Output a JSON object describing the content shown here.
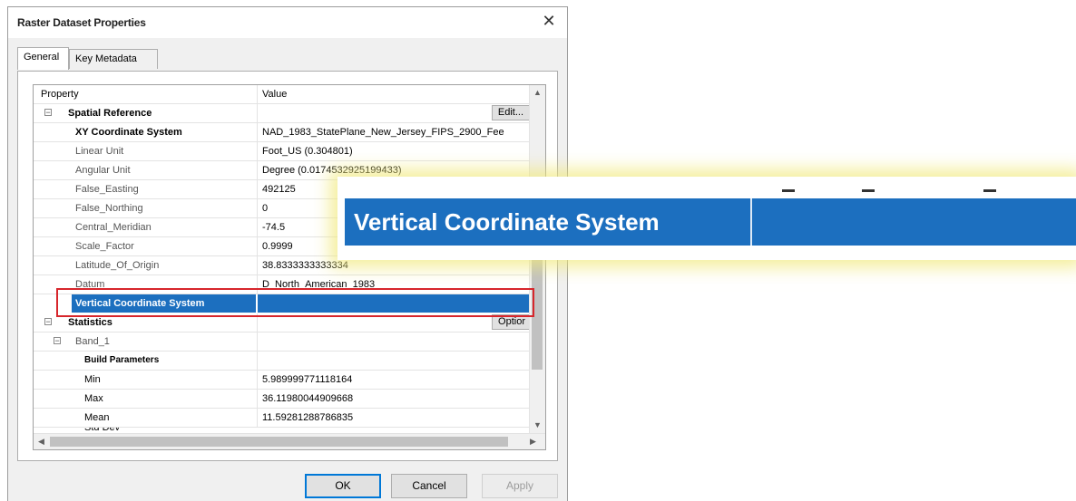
{
  "window": {
    "title": "Raster Dataset Properties",
    "close_glyph": "✕"
  },
  "tabs": [
    {
      "label": "General",
      "active": true
    },
    {
      "label": "Key Metadata",
      "active": false
    }
  ],
  "grid": {
    "header": {
      "property": "Property",
      "value": "Value"
    },
    "rows": [
      {
        "property": "Spatial Reference",
        "value": "",
        "button": "Edit..."
      },
      {
        "property": "XY Coordinate System",
        "value": "NAD_1983_StatePlane_New_Jersey_FIPS_2900_Fee"
      },
      {
        "property": "Linear Unit",
        "value": "Foot_US (0.304801)"
      },
      {
        "property": "Angular Unit",
        "value": "Degree (0.0174532925199433)"
      },
      {
        "property": "False_Easting",
        "value": "492125"
      },
      {
        "property": "False_Northing",
        "value": "0"
      },
      {
        "property": "Central_Meridian",
        "value": "-74.5"
      },
      {
        "property": "Scale_Factor",
        "value": "0.9999"
      },
      {
        "property": "Latitude_Of_Origin",
        "value": "38.8333333333334"
      },
      {
        "property": "Datum",
        "value": "D_North_American_1983"
      },
      {
        "property": "Vertical Coordinate System",
        "value": ""
      },
      {
        "property": "Statistics",
        "value": "",
        "button": "Optior"
      },
      {
        "property": "Band_1",
        "value": ""
      },
      {
        "property": "Build Parameters",
        "value": ""
      },
      {
        "property": "Min",
        "value": "5.989999771118164"
      },
      {
        "property": "Max",
        "value": "36.11980044909668"
      },
      {
        "property": "Mean",
        "value": "11.59281288786835"
      },
      {
        "property": "Std Dev",
        "value": ""
      }
    ]
  },
  "buttons": {
    "ok": "OK",
    "cancel": "Cancel",
    "apply": "Apply"
  },
  "callout": {
    "label": "Vertical Coordinate System"
  },
  "colors": {
    "selection": "#1c6fbf",
    "highlight_box": "#d7262c",
    "callout_glow": "#f0e878"
  }
}
